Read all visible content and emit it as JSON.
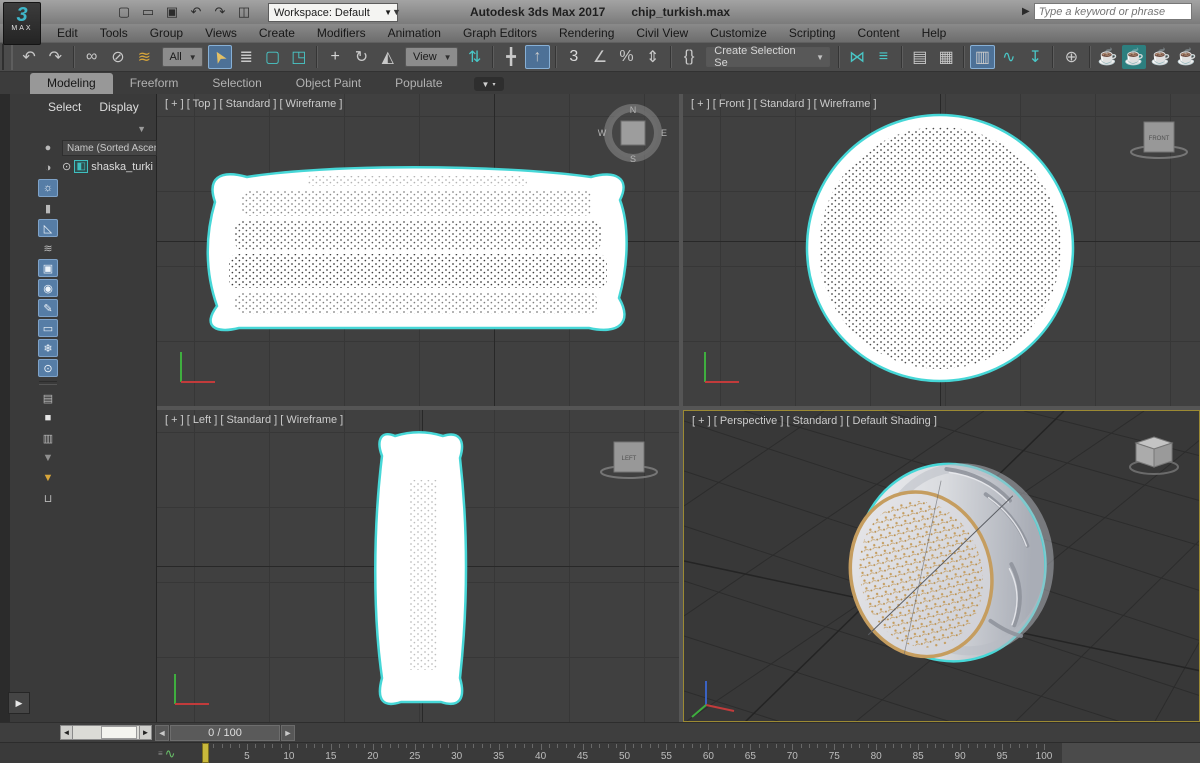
{
  "titlebar": {
    "logo_3": "3",
    "logo_max": "MAX",
    "app_title": "Autodesk 3ds Max 2017",
    "file_name": "chip_turkish.max",
    "workspace_label": "Workspace: Default",
    "search_placeholder": "Type a keyword or phrase",
    "quick_access": [
      {
        "t": "icon",
        "n": "new-scene-icon",
        "g": "▢"
      },
      {
        "t": "icon",
        "n": "open-file-icon",
        "g": "▭"
      },
      {
        "t": "icon",
        "n": "save-file-icon",
        "g": "▣"
      },
      {
        "t": "icon",
        "n": "undo-small-icon",
        "g": "↶"
      },
      {
        "t": "icon",
        "n": "redo-small-icon",
        "g": "↷"
      },
      {
        "t": "icon",
        "n": "project-folder-icon",
        "g": "◫"
      }
    ]
  },
  "menus": [
    "Edit",
    "Tools",
    "Group",
    "Views",
    "Create",
    "Modifiers",
    "Animation",
    "Graph Editors",
    "Rendering",
    "Civil View",
    "Customize",
    "Scripting",
    "Content",
    "Help"
  ],
  "toolbar": {
    "items": [
      {
        "t": "icon",
        "n": "undo-icon",
        "g": "↶"
      },
      {
        "t": "icon",
        "n": "redo-icon",
        "g": "↷"
      },
      {
        "t": "sep"
      },
      {
        "t": "icon",
        "n": "select-and-link-icon",
        "g": "∞"
      },
      {
        "t": "icon",
        "n": "unlink-selection-icon",
        "g": "⊘"
      },
      {
        "t": "icon",
        "n": "bind-to-space-warp-icon",
        "g": "≋",
        "c": "#d8a63a"
      },
      {
        "t": "dd",
        "n": "selection-filter-dropdown",
        "label": "All"
      },
      {
        "t": "icon",
        "n": "select-object-icon",
        "g": "➤",
        "c": "#e3c066",
        "rot": -120,
        "active": true
      },
      {
        "t": "icon",
        "n": "select-by-name-icon",
        "g": "≣"
      },
      {
        "t": "icon",
        "n": "rectangular-selection-region-icon",
        "g": "▢",
        "c": "#49c7c7"
      },
      {
        "t": "icon",
        "n": "window-crossing-toggle-icon",
        "g": "◳",
        "c": "#49c7c7"
      },
      {
        "t": "sep"
      },
      {
        "t": "icon",
        "n": "select-and-move-icon",
        "g": "+",
        "c": "#d6d6d6"
      },
      {
        "t": "icon",
        "n": "select-and-rotate-icon",
        "g": "↻"
      },
      {
        "t": "icon",
        "n": "select-and-scale-icon",
        "g": "◭"
      },
      {
        "t": "dd",
        "n": "reference-coordinate-system-dropdown",
        "label": "View"
      },
      {
        "t": "icon",
        "n": "use-pivot-point-center-icon",
        "g": "⇅",
        "c": "#49c7c7"
      },
      {
        "t": "sep"
      },
      {
        "t": "icon",
        "n": "select-and-manipulate-icon",
        "g": "╋"
      },
      {
        "t": "icon",
        "n": "keyboard-shortcut-override-icon",
        "g": "↑",
        "active": true
      },
      {
        "t": "sep"
      },
      {
        "t": "icon",
        "n": "snaps-toggle-3d-icon",
        "g": "3",
        "c": "#dcdcdc"
      },
      {
        "t": "icon",
        "n": "angle-snap-toggle-icon",
        "g": "∠"
      },
      {
        "t": "icon",
        "n": "percent-snap-toggle-icon",
        "g": "%"
      },
      {
        "t": "icon",
        "n": "spinner-snap-toggle-icon",
        "g": "⇕"
      },
      {
        "t": "sep"
      },
      {
        "t": "icon",
        "n": "edit-named-selection-sets-icon",
        "g": "{}"
      },
      {
        "t": "dd",
        "n": "create-selection-set-dropdown",
        "label": "Create Selection Se",
        "dark": true
      },
      {
        "t": "sep"
      },
      {
        "t": "icon",
        "n": "mirror-icon",
        "g": "⋈",
        "c": "#49c7c7"
      },
      {
        "t": "icon",
        "n": "align-icon",
        "g": "≡",
        "c": "#49c7c7"
      },
      {
        "t": "sep"
      },
      {
        "t": "icon",
        "n": "toggle-scene-explorer-icon",
        "g": "▤"
      },
      {
        "t": "icon",
        "n": "toggle-layer-explorer-icon",
        "g": "▦"
      },
      {
        "t": "sep"
      },
      {
        "t": "icon",
        "n": "toggle-ribbon-icon",
        "g": "▥",
        "active": true
      },
      {
        "t": "icon",
        "n": "curve-editor-icon",
        "g": "∿",
        "c": "#49c7c7"
      },
      {
        "t": "icon",
        "n": "schematic-view-icon",
        "g": "↧",
        "c": "#49c7c7"
      },
      {
        "t": "sep"
      },
      {
        "t": "icon",
        "n": "track-view-icon",
        "g": "⊕"
      },
      {
        "t": "sep"
      },
      {
        "t": "icon",
        "n": "render-setup-icon",
        "g": "☕",
        "c": "#d8a63a"
      },
      {
        "t": "icon",
        "n": "rendered-frame-window-icon",
        "g": "☕",
        "c": "#eaeaea",
        "bg": "#2d7f7f"
      },
      {
        "t": "icon",
        "n": "render-production-icon",
        "g": "☕"
      },
      {
        "t": "icon",
        "n": "render-iterative-icon",
        "g": "☕",
        "c": "#9fb6c9"
      }
    ]
  },
  "ribbon_tabs": [
    {
      "label": "Modeling",
      "active": true
    },
    {
      "label": "Freeform",
      "active": false
    },
    {
      "label": "Selection",
      "active": false
    },
    {
      "label": "Object Paint",
      "active": false
    },
    {
      "label": "Populate",
      "active": false
    }
  ],
  "scene_explorer": {
    "menu_select": "Select",
    "menu_display": "Display",
    "column_header": "Name (Sorted Ascending",
    "item_name": "shaska_turki",
    "toggles": [
      {
        "n": "display-objects-toggle",
        "g": "●"
      },
      {
        "n": "display-shapes-toggle",
        "g": "◑"
      },
      {
        "n": "display-lights-toggle",
        "g": "☼",
        "active": true
      },
      {
        "n": "display-cameras-toggle",
        "g": "▮"
      },
      {
        "n": "display-helpers-toggle",
        "g": "◺",
        "active": true
      },
      {
        "n": "display-space-warps-toggle",
        "g": "≋"
      },
      {
        "n": "display-groups-toggle",
        "g": "▣",
        "active": true
      },
      {
        "n": "display-xrefs-toggle",
        "g": "◉",
        "active": true
      },
      {
        "n": "display-bones-toggle",
        "g": "✎",
        "active": true
      },
      {
        "n": "display-containers-toggle",
        "g": "▭",
        "active": true
      },
      {
        "n": "display-frozen-toggle",
        "g": "❄",
        "active": true
      },
      {
        "n": "display-hidden-toggle",
        "g": "⊙",
        "active": true
      },
      {
        "t": "sep"
      },
      {
        "n": "expand-list-button",
        "g": "▤"
      },
      {
        "n": "selection-square-button",
        "g": "■",
        "c": "#e6e6e6"
      },
      {
        "n": "edit-list-button",
        "g": "▥"
      },
      {
        "n": "filter-combinations-button",
        "g": "▼",
        "c": "#8f8f8f"
      },
      {
        "n": "filter-button",
        "g": "▼",
        "c": "#d8a63a"
      },
      {
        "n": "new-folder-button",
        "g": "⊔"
      }
    ]
  },
  "viewports": {
    "top": {
      "label": "[ + ] [ Top ] [ Standard ] [ Wireframe ]"
    },
    "front": {
      "label": "[ + ] [ Front ] [ Standard ] [ Wireframe ]",
      "cube_label": "FRONT"
    },
    "left": {
      "label": "[ + ] [ Left ] [ Standard ] [ Wireframe ]",
      "cube_label": "LEFT"
    },
    "perspective": {
      "label": "[ + ] [ Perspective ] [ Standard ] [ Default Shading ]"
    }
  },
  "compass": {
    "n": "N",
    "e": "E",
    "s": "S",
    "w": "W"
  },
  "object": {
    "name": "shaska_turki"
  },
  "timeline": {
    "frame_display": "0 / 100",
    "start": 0,
    "end": 100,
    "label_step": 5,
    "current_frame": 0
  },
  "colors": {
    "selection_highlight": "#46d7d7",
    "gold_ornament": "#c59d5f",
    "active_button_blue": "#4d7197",
    "timeline_slider_yellow": "#c9b93b"
  }
}
